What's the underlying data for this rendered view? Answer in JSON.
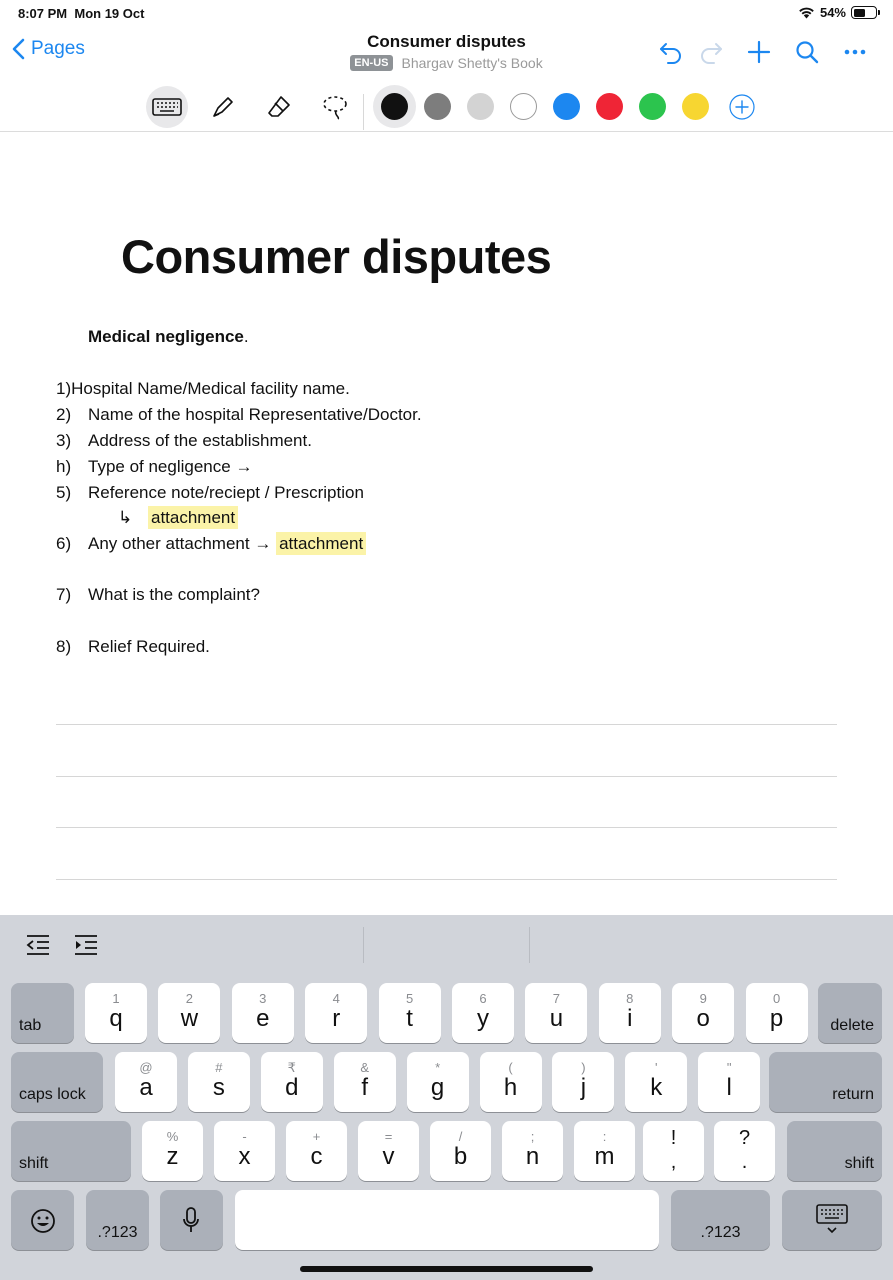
{
  "status": {
    "time": "8:07 PM",
    "date": "Mon 19 Oct",
    "battery": "54%",
    "battery_level": 0.54
  },
  "nav": {
    "back_label": "Pages",
    "title": "Consumer disputes",
    "lang_badge": "EN-US",
    "book": "Bhargav Shetty's Book",
    "icons": [
      "undo-icon",
      "redo-icon",
      "add-icon",
      "search-icon",
      "more-icon"
    ]
  },
  "toolbar": {
    "tools": [
      "keyboard-icon",
      "pen-icon",
      "eraser-icon",
      "lasso-icon"
    ],
    "colors": [
      "#111111",
      "#7d7d7d",
      "#d3d3d3",
      "#ffffff",
      "#1c87f0",
      "#ef2536",
      "#2cc44e",
      "#f7d631"
    ],
    "selected_color": "#111111"
  },
  "note": {
    "heading": "Consumer disputes",
    "subheading": "Medical negligence",
    "subheading_tail": ".",
    "items": [
      {
        "num": "1)",
        "text": "Hospital Name/Medical facility name."
      },
      {
        "num": "2)",
        "text": "Name of the hospital Representative/Doctor."
      },
      {
        "num": "3)",
        "text": "Address of the establishment."
      },
      {
        "num": "h)",
        "text": "Type of negligence →"
      },
      {
        "num": "5)",
        "text": "Reference note/reciept / Prescription"
      },
      {
        "num": "",
        "text": "↳",
        "highlight": "attachment"
      },
      {
        "num": "6)",
        "text": "Any other attachment →",
        "highlight": "attachment"
      },
      {
        "num": "7)",
        "text": "What is the complaint?"
      },
      {
        "num": "8)",
        "text": "Relief Required."
      }
    ]
  },
  "keyboard": {
    "row1": [
      {
        "k": "q",
        "s": "1"
      },
      {
        "k": "w",
        "s": "2"
      },
      {
        "k": "e",
        "s": "3"
      },
      {
        "k": "r",
        "s": "4"
      },
      {
        "k": "t",
        "s": "5"
      },
      {
        "k": "y",
        "s": "6"
      },
      {
        "k": "u",
        "s": "7"
      },
      {
        "k": "i",
        "s": "8"
      },
      {
        "k": "o",
        "s": "9"
      },
      {
        "k": "p",
        "s": "0"
      }
    ],
    "row2": [
      {
        "k": "a",
        "s": "@"
      },
      {
        "k": "s",
        "s": "#"
      },
      {
        "k": "d",
        "s": "₹"
      },
      {
        "k": "f",
        "s": "&"
      },
      {
        "k": "g",
        "s": "*"
      },
      {
        "k": "h",
        "s": "("
      },
      {
        "k": "j",
        "s": ")"
      },
      {
        "k": "k",
        "s": "'"
      },
      {
        "k": "l",
        "s": "\""
      }
    ],
    "row3": [
      {
        "k": "z",
        "s": "%"
      },
      {
        "k": "x",
        "s": "-"
      },
      {
        "k": "c",
        "s": "+"
      },
      {
        "k": "v",
        "s": "="
      },
      {
        "k": "b",
        "s": "/"
      },
      {
        "k": "n",
        "s": ";"
      },
      {
        "k": "m",
        "s": ":"
      }
    ],
    "punct": [
      {
        "top": "!",
        "bot": ","
      },
      {
        "top": "?",
        "bot": "."
      }
    ],
    "labels": {
      "tab": "tab",
      "delete": "delete",
      "caps": "caps lock",
      "return": "return",
      "shift": "shift",
      "num": ".?123"
    }
  }
}
